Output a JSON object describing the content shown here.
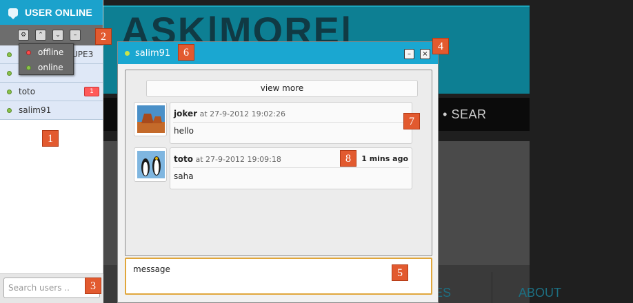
{
  "sidebar": {
    "title": "USER ONLINE",
    "toolbar": {
      "settings_symbol": "⚙",
      "up_symbol": "⌃",
      "down_symbol": "⌄",
      "minimize_symbol": "–"
    },
    "status_menu": [
      {
        "label": "offline",
        "dot_color": "#ff4d4d"
      },
      {
        "label": "online",
        "dot_color": "#8bc34a"
      }
    ],
    "partial_group_label": "UPE3",
    "users": [
      {
        "name": "toto",
        "unread": "1"
      },
      {
        "name": "salim91",
        "unread": ""
      }
    ],
    "search_placeholder": "Search users .."
  },
  "chat": {
    "title": "salim91",
    "minimize_symbol": "–",
    "close_symbol": "×",
    "view_more": "view more",
    "messages": [
      {
        "author": "joker",
        "at": "at",
        "timestamp": "27-9-2012 19:02:26",
        "text": "hello",
        "ago": ""
      },
      {
        "author": "toto",
        "at": "at",
        "timestamp": "27-9-2012 19:09:18",
        "text": "saha",
        "ago": "1 mins ago"
      }
    ],
    "input_value": "message"
  },
  "background_site": {
    "logo": "ASK|MORE|",
    "nav": "ATION  •  SERVICES  •  SEAR",
    "bottom_left": "ES",
    "bottom_right": "ABOUT"
  },
  "badges": [
    "1",
    "2",
    "3",
    "4",
    "5",
    "6",
    "7",
    "8"
  ],
  "colors": {
    "accent": "#1aa7d1",
    "badge": "#e25a2f",
    "unread": "#ff5a5a",
    "input_focus": "#e0a63b"
  }
}
